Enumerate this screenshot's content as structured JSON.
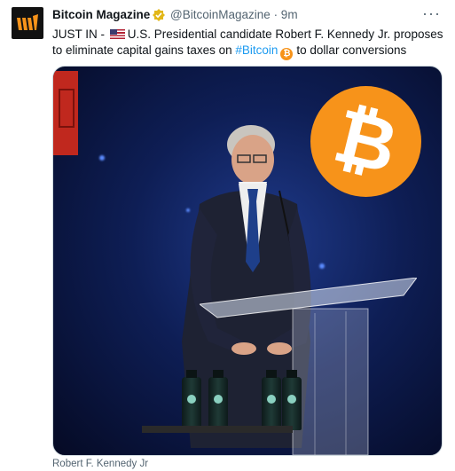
{
  "author": {
    "name": "Bitcoin Magazine",
    "handle": "@BitcoinMagazine",
    "time": "· 9m",
    "avatar_icon": "bitcoin-magazine-logo"
  },
  "tweet": {
    "prefix": "JUST IN - ",
    "flag_icon": "us-flag-emoji",
    "body": "U.S. Presidential candidate Robert F. Kennedy Jr. proposes to eliminate capital gains taxes on ",
    "hashtag": "#Bitcoin",
    "btc_emoji_symbol": "₿",
    "suffix": "to dollar conversions"
  },
  "media": {
    "bitcoin_symbol": "₿",
    "caption": "Robert F. Kennedy Jr"
  },
  "more_glyph": "···",
  "colors": {
    "accent": "#1d9bf0",
    "bitcoin_orange": "#f7931a",
    "verified_gold": "#e2b719"
  }
}
